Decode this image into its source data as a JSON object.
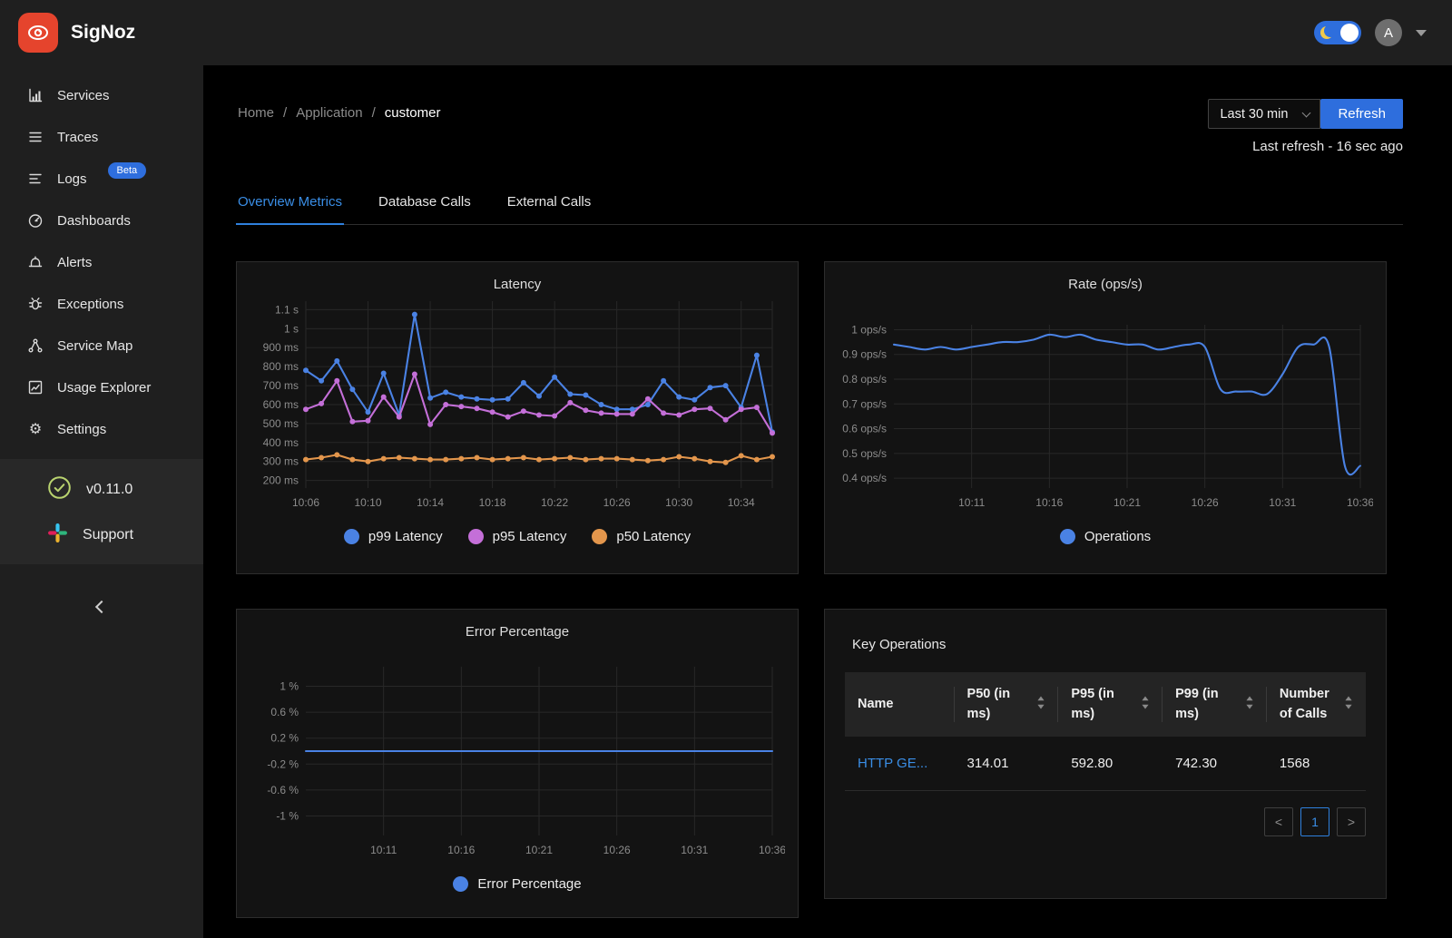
{
  "header": {
    "brand": "SigNoz",
    "avatar_initial": "A"
  },
  "sidebar": {
    "items": [
      {
        "label": "Services",
        "icon": "bar-chart"
      },
      {
        "label": "Traces",
        "icon": "align-lines"
      },
      {
        "label": "Logs",
        "icon": "log-lines",
        "badge": "Beta"
      },
      {
        "label": "Dashboards",
        "icon": "dashboard-gauge"
      },
      {
        "label": "Alerts",
        "icon": "alarm-bell"
      },
      {
        "label": "Exceptions",
        "icon": "bug"
      },
      {
        "label": "Service Map",
        "icon": "node-graph"
      },
      {
        "label": "Usage Explorer",
        "icon": "line-chart"
      },
      {
        "label": "Settings",
        "icon": "gear"
      }
    ],
    "version": "v0.11.0",
    "support_label": "Support"
  },
  "breadcrumb": {
    "separator": "/",
    "items": [
      {
        "label": "Home",
        "current": false
      },
      {
        "label": "Application",
        "current": false
      },
      {
        "label": "customer",
        "current": true
      }
    ]
  },
  "time_controls": {
    "range_label": "Last 30 min",
    "refresh_label": "Refresh",
    "last_refresh_text": "Last refresh - 16 sec ago"
  },
  "tabs": [
    {
      "label": "Overview Metrics",
      "active": true
    },
    {
      "label": "Database Calls",
      "active": false
    },
    {
      "label": "External Calls",
      "active": false
    }
  ],
  "colors": {
    "accent": "#2e6edd",
    "link": "#3a8ee6",
    "chart_blue": "#4a82e4",
    "chart_purple": "#c46fd8",
    "chart_orange": "#e3964c",
    "grid": "#282828",
    "tick_text": "#8c8c8c",
    "logo_red": "#e5442d",
    "version_green": "#b9d36f",
    "slack": [
      "#36C5F0",
      "#2EB67D",
      "#ECB22E",
      "#E01E5A"
    ]
  },
  "chart_data": [
    {
      "id": "latency",
      "type": "line",
      "title": "Latency",
      "x_start": "10:06",
      "x_end": "10:36",
      "interval_min": 1,
      "grid": true,
      "legend_position": "bottom",
      "ylim": [
        160,
        1145
      ],
      "y_ticks": [
        {
          "label": "1.1 s",
          "value": 1100
        },
        {
          "label": "1 s",
          "value": 1000
        },
        {
          "label": "900 ms",
          "value": 900
        },
        {
          "label": "800 ms",
          "value": 800
        },
        {
          "label": "700 ms",
          "value": 700
        },
        {
          "label": "600 ms",
          "value": 600
        },
        {
          "label": "500 ms",
          "value": 500
        },
        {
          "label": "400 ms",
          "value": 400
        },
        {
          "label": "300 ms",
          "value": 300
        },
        {
          "label": "200 ms",
          "value": 200
        }
      ],
      "x_ticks": [
        {
          "label": "10:06",
          "t": 0
        },
        {
          "label": "10:10",
          "t": 0.1333
        },
        {
          "label": "10:14",
          "t": 0.2667
        },
        {
          "label": "10:18",
          "t": 0.4
        },
        {
          "label": "10:22",
          "t": 0.5333
        },
        {
          "label": "10:26",
          "t": 0.6667
        },
        {
          "label": "10:30",
          "t": 0.8
        },
        {
          "label": "10:34",
          "t": 0.9333
        }
      ],
      "extra_vlines": [
        1
      ],
      "series": [
        {
          "name": "p99 Latency",
          "color": "#4a82e4",
          "markers": true,
          "smooth": false,
          "values": [
            780,
            725,
            830,
            680,
            560,
            765,
            545,
            1075,
            635,
            665,
            640,
            630,
            625,
            630,
            715,
            645,
            745,
            655,
            650,
            600,
            575,
            575,
            600,
            725,
            640,
            625,
            690,
            700,
            585,
            860,
            455
          ]
        },
        {
          "name": "p95 Latency",
          "color": "#c46fd8",
          "markers": true,
          "smooth": false,
          "values": [
            575,
            605,
            725,
            510,
            515,
            640,
            535,
            760,
            495,
            600,
            590,
            580,
            560,
            535,
            565,
            545,
            540,
            610,
            570,
            555,
            550,
            550,
            630,
            555,
            545,
            575,
            580,
            520,
            575,
            585,
            450
          ]
        },
        {
          "name": "p50 Latency",
          "color": "#e3964c",
          "markers": true,
          "smooth": false,
          "values": [
            310,
            320,
            335,
            310,
            300,
            315,
            320,
            315,
            310,
            310,
            315,
            320,
            310,
            315,
            320,
            310,
            315,
            320,
            310,
            315,
            315,
            310,
            305,
            310,
            325,
            315,
            300,
            295,
            330,
            310,
            325
          ]
        }
      ]
    },
    {
      "id": "rate",
      "type": "line",
      "title": "Rate (ops/s)",
      "x_start": "10:06",
      "x_end": "10:36",
      "interval_min": 1,
      "grid": true,
      "legend_position": "bottom",
      "ylim": [
        0.36,
        1.02
      ],
      "y_ticks": [
        {
          "label": "1 ops/s",
          "value": 1.0
        },
        {
          "label": "0.9 ops/s",
          "value": 0.9
        },
        {
          "label": "0.8 ops/s",
          "value": 0.8
        },
        {
          "label": "0.7 ops/s",
          "value": 0.7
        },
        {
          "label": "0.6 ops/s",
          "value": 0.6
        },
        {
          "label": "0.5 ops/s",
          "value": 0.5
        },
        {
          "label": "0.4 ops/s",
          "value": 0.4
        }
      ],
      "x_ticks": [
        {
          "label": "10:11",
          "t": 0.1667
        },
        {
          "label": "10:16",
          "t": 0.3333
        },
        {
          "label": "10:21",
          "t": 0.5
        },
        {
          "label": "10:26",
          "t": 0.6667
        },
        {
          "label": "10:31",
          "t": 0.8333
        },
        {
          "label": "10:36",
          "t": 1
        }
      ],
      "extra_vlines": [],
      "series": [
        {
          "name": "Operations",
          "color": "#4a82e4",
          "markers": false,
          "smooth": true,
          "values": [
            0.94,
            0.93,
            0.92,
            0.93,
            0.92,
            0.93,
            0.94,
            0.95,
            0.95,
            0.96,
            0.98,
            0.97,
            0.98,
            0.96,
            0.95,
            0.94,
            0.94,
            0.92,
            0.93,
            0.94,
            0.93,
            0.76,
            0.75,
            0.75,
            0.74,
            0.82,
            0.93,
            0.94,
            0.93,
            0.45,
            0.45
          ]
        }
      ]
    },
    {
      "id": "error",
      "type": "line",
      "title": "Error Percentage",
      "x_start": "10:06",
      "x_end": "10:36",
      "interval_min": 1,
      "grid": true,
      "legend_position": "bottom",
      "ylim": [
        -1.3,
        1.3
      ],
      "y_ticks": [
        {
          "label": "1 %",
          "value": 1
        },
        {
          "label": "0.6 %",
          "value": 0.6
        },
        {
          "label": "0.2 %",
          "value": 0.2
        },
        {
          "label": "-0.2 %",
          "value": -0.2
        },
        {
          "label": "-0.6 %",
          "value": -0.6
        },
        {
          "label": "-1 %",
          "value": -1
        }
      ],
      "x_ticks": [
        {
          "label": "10:11",
          "t": 0.1667
        },
        {
          "label": "10:16",
          "t": 0.3333
        },
        {
          "label": "10:21",
          "t": 0.5
        },
        {
          "label": "10:26",
          "t": 0.6667
        },
        {
          "label": "10:31",
          "t": 0.8333
        },
        {
          "label": "10:36",
          "t": 1
        }
      ],
      "extra_vlines": [],
      "series": [
        {
          "name": "Error Percentage",
          "color": "#4a82e4",
          "markers": false,
          "smooth": false,
          "values": [
            0,
            0,
            0,
            0,
            0,
            0,
            0,
            0,
            0,
            0,
            0,
            0,
            0,
            0,
            0,
            0,
            0,
            0,
            0,
            0,
            0,
            0,
            0,
            0,
            0,
            0,
            0,
            0,
            0,
            0,
            0
          ]
        }
      ]
    }
  ],
  "key_operations": {
    "title": "Key Operations",
    "columns": [
      {
        "label": "Name",
        "sortable": false
      },
      {
        "label": "P50 (in ms)",
        "sortable": true
      },
      {
        "label": "P95 (in ms)",
        "sortable": true
      },
      {
        "label": "P99 (in ms)",
        "sortable": true
      },
      {
        "label": "Number of Calls",
        "sortable": true
      }
    ],
    "rows": [
      {
        "cells": [
          "HTTP GE...",
          "314.01",
          "592.80",
          "742.30",
          "1568"
        ],
        "link_first": true
      }
    ],
    "pagination": {
      "prev": "<",
      "current": "1",
      "next": ">"
    }
  }
}
